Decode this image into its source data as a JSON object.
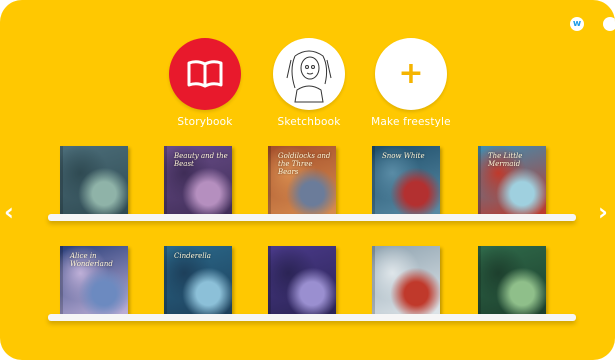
{
  "modes": [
    {
      "label": "Storybook"
    },
    {
      "label": "Sketchbook"
    },
    {
      "label": "Make freestyle"
    }
  ],
  "header_icons": [
    {
      "name": "w-icon",
      "glyph": "w"
    },
    {
      "name": "partial-icon",
      "glyph": ""
    }
  ],
  "shelves": [
    {
      "books": [
        {
          "title": "",
          "colors": [
            "#4c6e7a",
            "#8fb3a8",
            "#2f4a52"
          ]
        },
        {
          "title": "Beauty and the Beast",
          "colors": [
            "#6a4e8a",
            "#b58fbf",
            "#3f2d57"
          ]
        },
        {
          "title": "Goldilocks and the Three Bears",
          "colors": [
            "#a34e2b",
            "#6b7c9a",
            "#d88d4f"
          ]
        },
        {
          "title": "Snow White",
          "colors": [
            "#1e4e6a",
            "#b33030",
            "#5a8ca6"
          ]
        },
        {
          "title": "The Little Mermaid",
          "colors": [
            "#3f8fb3",
            "#9fd0df",
            "#c0392b"
          ]
        }
      ]
    },
    {
      "books": [
        {
          "title": "Alice in Wonderland",
          "colors": [
            "#2a3f7a",
            "#6c8ac0",
            "#bfb0d8"
          ]
        },
        {
          "title": "Cinderella",
          "colors": [
            "#2b6a8c",
            "#8cc0d8",
            "#1d3f5a"
          ]
        },
        {
          "title": "",
          "colors": [
            "#4a3a8a",
            "#9a8fd0",
            "#2b2455"
          ]
        },
        {
          "title": "",
          "colors": [
            "#8fa3b0",
            "#c0392b",
            "#dfe6ea"
          ]
        },
        {
          "title": "",
          "colors": [
            "#2f6a4a",
            "#8fbf8a",
            "#1d3f2d"
          ]
        }
      ]
    }
  ],
  "nav": {
    "prev": "‹",
    "next": "›"
  }
}
